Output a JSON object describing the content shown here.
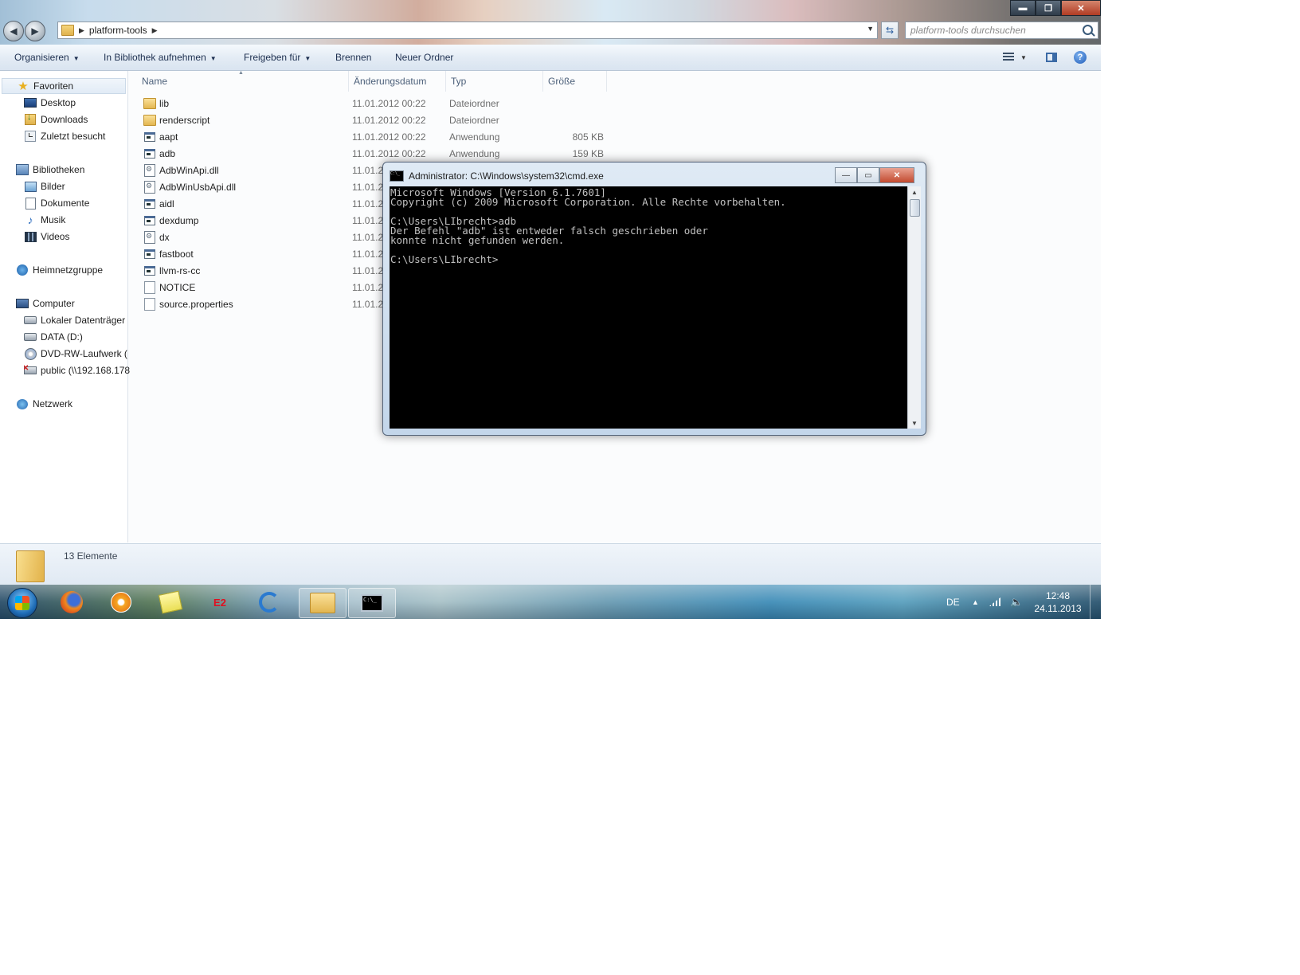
{
  "explorer": {
    "address": {
      "crumb": "platform-tools"
    },
    "search": {
      "placeholder": "platform-tools durchsuchen"
    },
    "window_controls": {
      "minimize": "▬",
      "maximize": "❐",
      "close": "✕"
    },
    "toolbar": {
      "organize": "Organisieren",
      "include_library": "In Bibliothek aufnehmen",
      "share": "Freigeben für",
      "burn": "Brennen",
      "new_folder": "Neuer Ordner"
    },
    "nav": {
      "favorites": "Favoriten",
      "desktop": "Desktop",
      "downloads": "Downloads",
      "recent": "Zuletzt besucht",
      "libraries": "Bibliotheken",
      "pictures": "Bilder",
      "documents": "Dokumente",
      "music": "Musik",
      "videos": "Videos",
      "homegroup": "Heimnetzgruppe",
      "computer": "Computer",
      "local_disk": "Lokaler Datenträger",
      "data_d": "DATA (D:)",
      "dvd": "DVD-RW-Laufwerk (",
      "public": "public (\\\\192.168.178",
      "network": "Netzwerk"
    },
    "columns": {
      "name": "Name",
      "date": "Änderungsdatum",
      "type": "Typ",
      "size": "Größe"
    },
    "files": [
      {
        "name": "lib",
        "date": "11.01.2012 00:22",
        "type": "Dateiordner",
        "size": "",
        "icon": "folder-icon"
      },
      {
        "name": "renderscript",
        "date": "11.01.2012 00:22",
        "type": "Dateiordner",
        "size": "",
        "icon": "folder-icon"
      },
      {
        "name": "aapt",
        "date": "11.01.2012 00:22",
        "type": "Anwendung",
        "size": "805 KB",
        "icon": "exe-icon"
      },
      {
        "name": "adb",
        "date": "11.01.2012 00:22",
        "type": "Anwendung",
        "size": "159 KB",
        "icon": "exe-icon"
      },
      {
        "name": "AdbWinApi.dll",
        "date": "11.01.2",
        "type": "",
        "size": "",
        "icon": "dll-icon"
      },
      {
        "name": "AdbWinUsbApi.dll",
        "date": "11.01.2",
        "type": "",
        "size": "",
        "icon": "dll-icon"
      },
      {
        "name": "aidl",
        "date": "11.01.2",
        "type": "",
        "size": "",
        "icon": "exe-icon"
      },
      {
        "name": "dexdump",
        "date": "11.01.2",
        "type": "",
        "size": "",
        "icon": "exe-icon"
      },
      {
        "name": "dx",
        "date": "11.01.2",
        "type": "",
        "size": "",
        "icon": "dll-icon"
      },
      {
        "name": "fastboot",
        "date": "11.01.2",
        "type": "",
        "size": "",
        "icon": "exe-icon"
      },
      {
        "name": "llvm-rs-cc",
        "date": "11.01.2",
        "type": "",
        "size": "",
        "icon": "exe-icon"
      },
      {
        "name": "NOTICE",
        "date": "11.01.2",
        "type": "",
        "size": "",
        "icon": "file-icon"
      },
      {
        "name": "source.properties",
        "date": "11.01.2",
        "type": "",
        "size": "",
        "icon": "file-icon"
      }
    ],
    "details": {
      "count": "13 Elemente"
    }
  },
  "cmd": {
    "title": "Administrator: C:\\Windows\\system32\\cmd.exe",
    "icon_text": "C:\\_",
    "controls": {
      "minimize": "—",
      "maximize": "▭",
      "close": "✕"
    },
    "lines": [
      "Microsoft Windows [Version 6.1.7601]",
      "Copyright (c) 2009 Microsoft Corporation. Alle Rechte vorbehalten.",
      "",
      "C:\\Users\\LIbrecht>adb",
      "Der Befehl \"adb\" ist entweder falsch geschrieben oder",
      "konnte nicht gefunden werden.",
      "",
      "C:\\Users\\LIbrecht>"
    ]
  },
  "taskbar": {
    "apps": [
      "firefox-icon",
      "media-player-icon",
      "sticky-notes-icon",
      "e2-satellite-icon",
      "ie-icon",
      "explorer-icon",
      "cmd-icon"
    ],
    "e2_label": "E2",
    "cmd_icon_text": "C:\\_",
    "language": "DE",
    "time": "12:48",
    "date": "24.11.2013"
  }
}
